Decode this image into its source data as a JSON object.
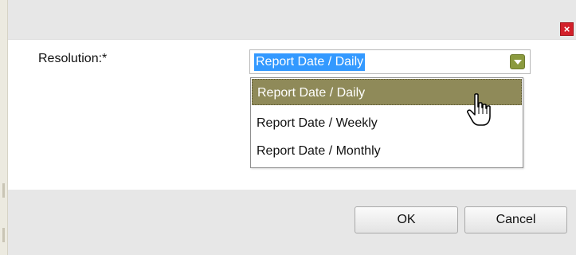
{
  "dialog": {
    "close_symbol": "×",
    "close_icon": "close-icon",
    "field_label": "Resolution:*",
    "select": {
      "value": "Report Date / Daily",
      "arrow_icon": "chevron-down-icon"
    },
    "options": [
      {
        "label": "Report Date / Daily",
        "highlighted": true
      },
      {
        "label": "Report Date / Weekly",
        "highlighted": false
      },
      {
        "label": "Report Date / Monthly",
        "highlighted": false
      }
    ],
    "buttons": {
      "ok": "OK",
      "cancel": "Cancel"
    },
    "cursor_icon": "hand-pointer-icon"
  },
  "colors": {
    "highlight": "#8f8a59",
    "selection": "#3399ff",
    "close": "#d3202a",
    "arrow": "#8b9a3f"
  }
}
